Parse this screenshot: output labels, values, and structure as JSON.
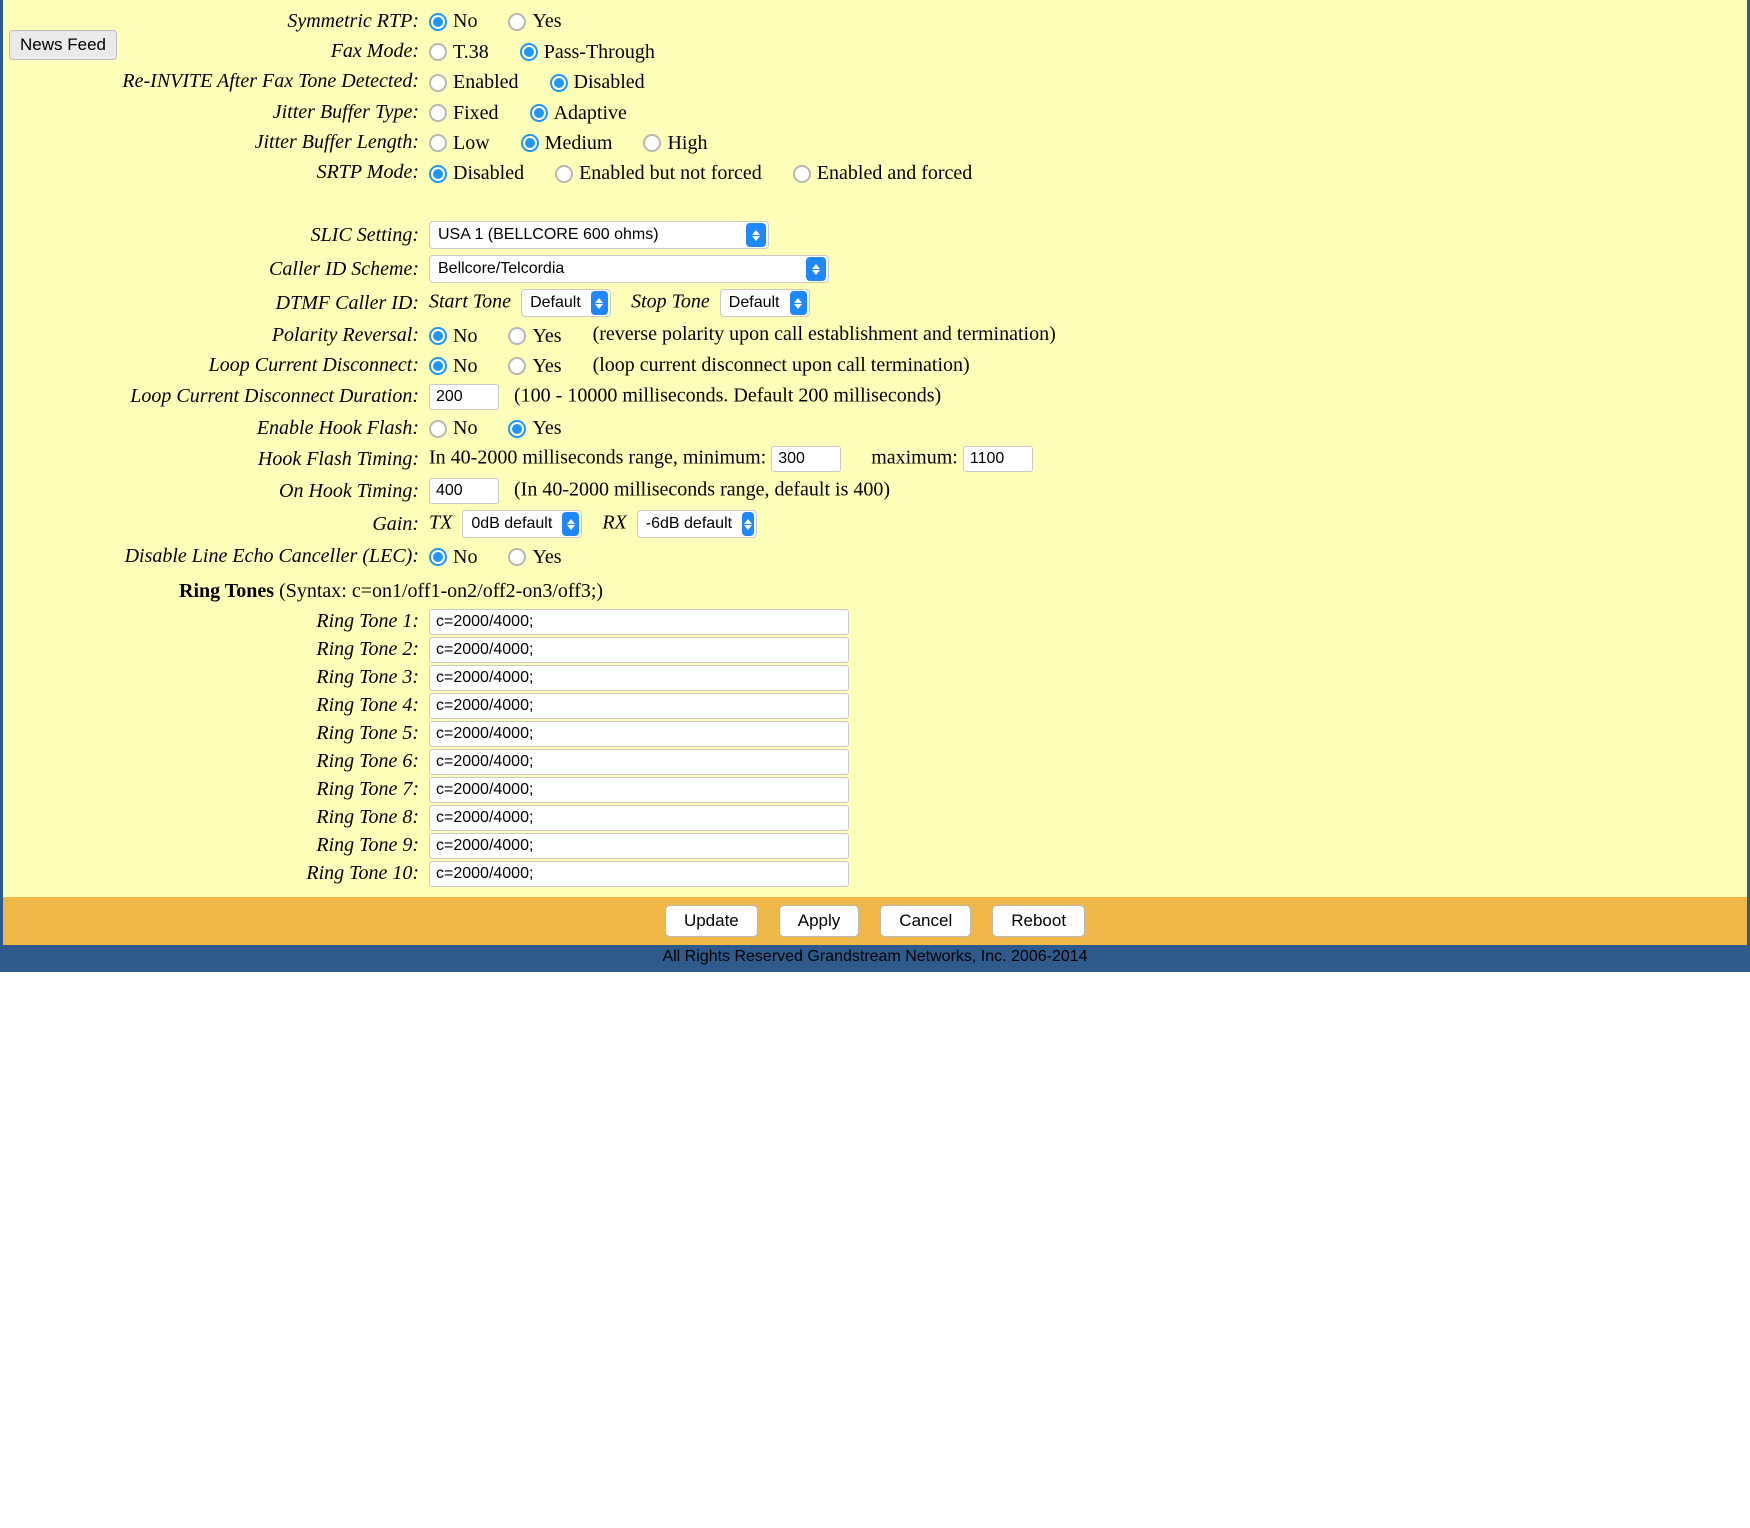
{
  "news_feed": "News Feed",
  "rows": {
    "symmetric_rtp": {
      "label": "Symmetric RTP:",
      "options": [
        "No",
        "Yes"
      ],
      "selected": 0
    },
    "fax_mode": {
      "label": "Fax Mode:",
      "options": [
        "T.38",
        "Pass-Through"
      ],
      "selected": 1
    },
    "reinvite_fax": {
      "label": "Re-INVITE After Fax Tone Detected:",
      "options": [
        "Enabled",
        "Disabled"
      ],
      "selected": 1
    },
    "jitter_type": {
      "label": "Jitter Buffer Type:",
      "options": [
        "Fixed",
        "Adaptive"
      ],
      "selected": 1
    },
    "jitter_length": {
      "label": "Jitter Buffer Length:",
      "options": [
        "Low",
        "Medium",
        "High"
      ],
      "selected": 1
    },
    "srtp_mode": {
      "label": "SRTP Mode:",
      "options": [
        "Disabled",
        "Enabled but not forced",
        "Enabled and forced"
      ],
      "selected": 0
    },
    "slic": {
      "label": "SLIC Setting:",
      "value": "USA 1 (BELLCORE 600 ohms)"
    },
    "cid_scheme": {
      "label": "Caller ID Scheme:",
      "value": "Bellcore/Telcordia"
    },
    "dtmf_cid": {
      "label": "DTMF Caller ID:",
      "start_label": "Start Tone",
      "start_value": "Default",
      "stop_label": "Stop Tone",
      "stop_value": "Default"
    },
    "polarity": {
      "label": "Polarity Reversal:",
      "options": [
        "No",
        "Yes"
      ],
      "selected": 0,
      "hint": "(reverse polarity upon call establishment and termination)"
    },
    "loop_disc": {
      "label": "Loop Current Disconnect:",
      "options": [
        "No",
        "Yes"
      ],
      "selected": 0,
      "hint": "(loop current disconnect upon call termination)"
    },
    "loop_dur": {
      "label": "Loop Current Disconnect Duration:",
      "value": "200",
      "hint": "(100 - 10000 milliseconds. Default 200 milliseconds)"
    },
    "hook_flash": {
      "label": "Enable Hook Flash:",
      "options": [
        "No",
        "Yes"
      ],
      "selected": 1
    },
    "hook_timing": {
      "label": "Hook Flash Timing:",
      "prefix": "In 40-2000 milliseconds range, minimum:",
      "min": "300",
      "max_label": "maximum:",
      "max": "1100"
    },
    "on_hook": {
      "label": "On Hook Timing:",
      "value": "400",
      "hint": "(In 40-2000 milliseconds range, default is 400)"
    },
    "gain": {
      "label": "Gain:",
      "tx_label": "TX",
      "tx_value": "0dB default",
      "rx_label": "RX",
      "rx_value": "-6dB default"
    },
    "lec": {
      "label": "Disable Line Echo Canceller (LEC):",
      "options": [
        "No",
        "Yes"
      ],
      "selected": 0
    }
  },
  "ring_header_bold": "Ring Tones",
  "ring_header_rest": " (Syntax: c=on1/off1-on2/off2-on3/off3;)",
  "ring_tones": [
    {
      "label": "Ring Tone 1:",
      "value": "c=2000/4000;"
    },
    {
      "label": "Ring Tone 2:",
      "value": "c=2000/4000;"
    },
    {
      "label": "Ring Tone 3:",
      "value": "c=2000/4000;"
    },
    {
      "label": "Ring Tone 4:",
      "value": "c=2000/4000;"
    },
    {
      "label": "Ring Tone 5:",
      "value": "c=2000/4000;"
    },
    {
      "label": "Ring Tone 6:",
      "value": "c=2000/4000;"
    },
    {
      "label": "Ring Tone 7:",
      "value": "c=2000/4000;"
    },
    {
      "label": "Ring Tone 8:",
      "value": "c=2000/4000;"
    },
    {
      "label": "Ring Tone 9:",
      "value": "c=2000/4000;"
    },
    {
      "label": "Ring Tone 10:",
      "value": "c=2000/4000;"
    }
  ],
  "buttons": {
    "update": "Update",
    "apply": "Apply",
    "cancel": "Cancel",
    "reboot": "Reboot"
  },
  "footer": "All Rights Reserved Grandstream Networks, Inc. 2006-2014"
}
